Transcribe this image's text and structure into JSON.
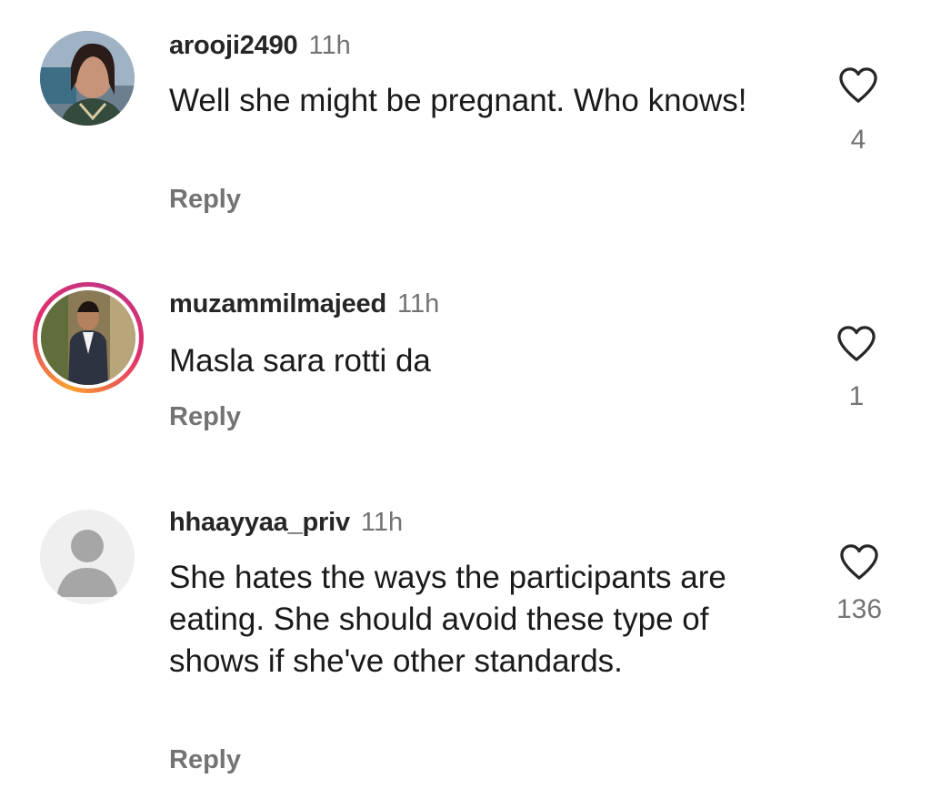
{
  "comments": [
    {
      "username": "arooji2490",
      "time": "11h",
      "text": "Well she might be pregnant. Who knows!",
      "reply_label": "Reply",
      "likes": "4",
      "has_story_ring": false
    },
    {
      "username": "muzammilmajeed",
      "time": "11h",
      "text": "Masla sara rotti da",
      "reply_label": "Reply",
      "likes": "1",
      "has_story_ring": true
    },
    {
      "username": "hhaayyaa_priv",
      "time": "11h",
      "text": "She hates the ways the participants are eating. She should avoid these type of shows if she've other standards.",
      "reply_label": "Reply",
      "likes": "136",
      "has_story_ring": false
    }
  ],
  "icons": {
    "like": "heart-outline-icon",
    "default_avatar": "person-silhouette-icon"
  },
  "colors": {
    "text_primary": "#262626",
    "text_secondary": "#737373",
    "story_ring_start": "#f9a12e",
    "story_ring_end": "#c13584"
  }
}
